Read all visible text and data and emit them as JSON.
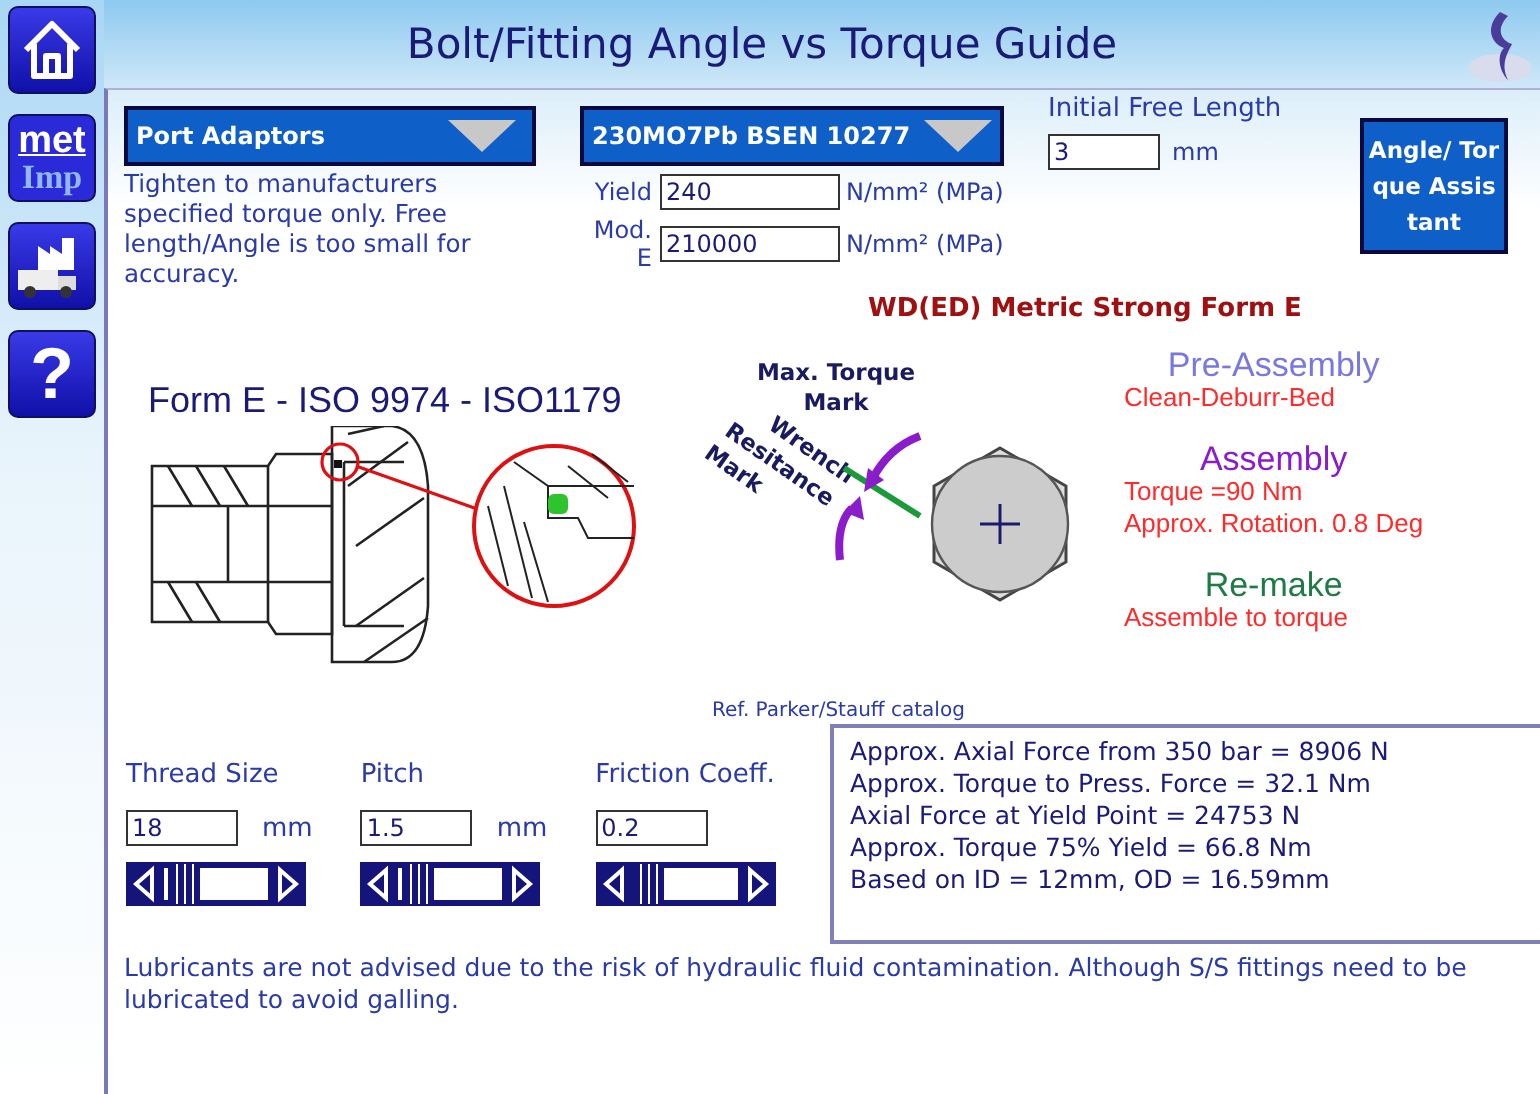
{
  "window": {
    "title": "Bolt/Fitting Angle vs Torque Guide"
  },
  "sidebar": {
    "buttons": [
      {
        "kind": "home"
      },
      {
        "kind": "units",
        "label_top": "met",
        "label_bottom": "Imp"
      },
      {
        "kind": "factory"
      },
      {
        "kind": "help",
        "label": "?"
      }
    ]
  },
  "selectors": [
    {
      "value": "Port Adaptors"
    },
    {
      "value": "230MO7Pb BSEN 10277"
    }
  ],
  "note": "Tighten to manufacturers specified torque only. Free length/Angle is too small for accuracy.",
  "material": [
    {
      "label": "Yield",
      "value": "240",
      "unit": "N/mm² (MPa)"
    },
    {
      "label": "Mod. E",
      "value": "210000",
      "unit": "N/mm² (MPa)"
    }
  ],
  "free_length": {
    "label": "Initial Free Length",
    "value": "3",
    "unit": "mm"
  },
  "assistant_button": "Angle/ Torque Assistant",
  "fitting_title": "WD(ED) Metric Strong Form E",
  "form_diagram": {
    "title": "Form E - ISO 9974 - ISO1179"
  },
  "torque_diagram": {
    "max_label": [
      "Max. Torque",
      "Mark"
    ],
    "wrench_label": [
      "Wrench",
      "Resitance",
      "Mark"
    ],
    "reference": "Ref. Parker/Stauff catalog"
  },
  "stages": [
    {
      "heading": "Pre-Assembly",
      "color": "#7878e0",
      "lines": [
        "Clean-Deburr-Bed"
      ]
    },
    {
      "heading": "Assembly",
      "color": "#8a1ccc",
      "lines": [
        "Torque =90 Nm",
        "Approx. Rotation. 0.8 Deg"
      ]
    },
    {
      "heading": "Re-make",
      "color": "#1f7a46",
      "lines": [
        "Assemble to torque"
      ]
    }
  ],
  "parameters": [
    {
      "label": "Thread Size",
      "value": "18",
      "unit": "mm",
      "level": 0.18
    },
    {
      "label": "Pitch",
      "value": "1.5",
      "unit": "mm",
      "level": 0.16
    },
    {
      "label": "Friction Coeff.",
      "value": "0.2",
      "level": 0.12
    }
  ],
  "results": [
    "Approx. Axial Force from 350 bar = 8906 N",
    "Approx. Torque to Press. Force = 32.1 Nm",
    "Axial Force at Yield Point = 24753 N",
    "Approx. Torque 75% Yield = 66.8 Nm",
    "Based on ID = 12mm, OD = 16.59mm"
  ],
  "lubricant_note": "Lubricants are not advised due to the risk of hydraulic fluid contamination. Although S/S fittings need to be lubricated to avoid galling."
}
